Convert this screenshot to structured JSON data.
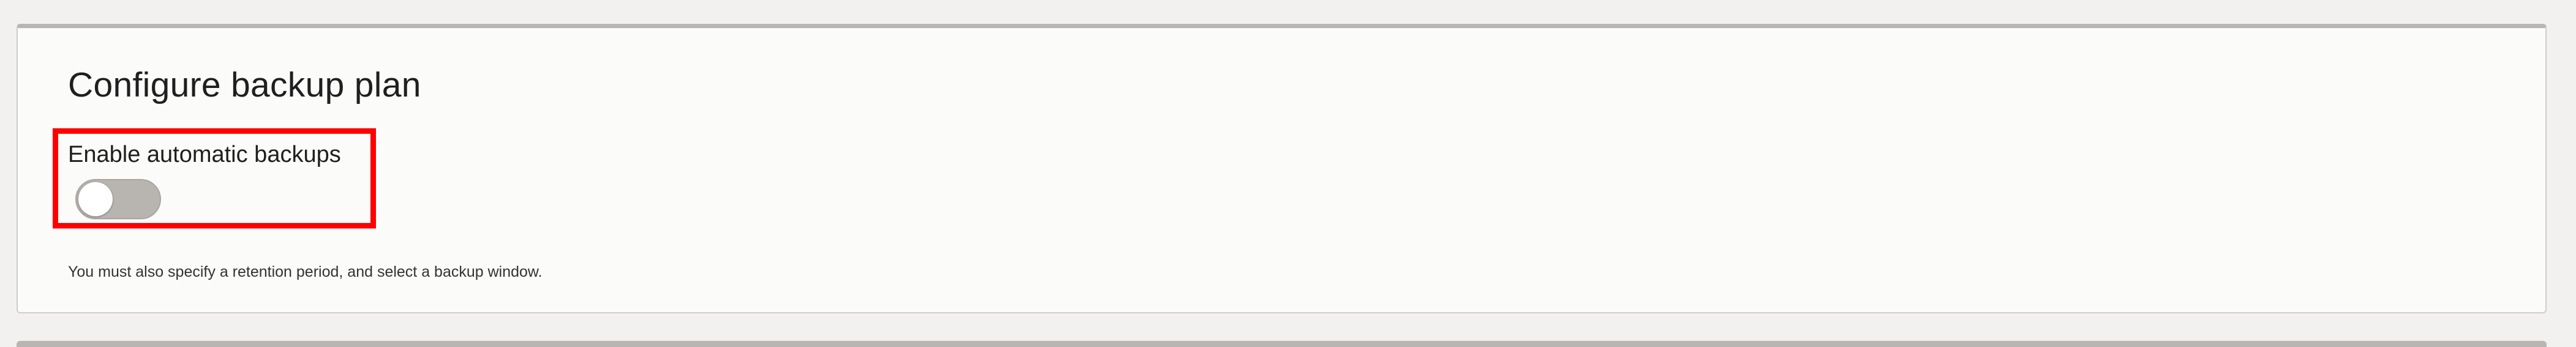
{
  "panel": {
    "title": "Configure backup plan",
    "toggle": {
      "label": "Enable automatic backups",
      "state": "off"
    },
    "help_text": "You must also specify a retention period, and select a backup window."
  },
  "colors": {
    "highlight": "#ff0000",
    "toggle_track": "#b8b4b0",
    "panel_background": "#fbfbf9",
    "page_background": "#f2f1ef"
  }
}
